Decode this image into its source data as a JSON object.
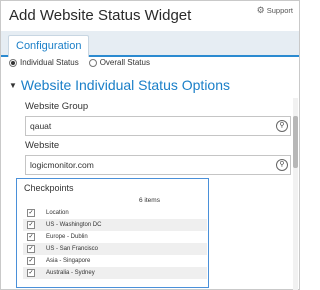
{
  "dialog": {
    "title": "Add Website Status Widget",
    "support_label": "Support",
    "support_icon": "gear-icon"
  },
  "tabs": [
    {
      "label": "Configuration",
      "active": true
    }
  ],
  "status_type": {
    "options": [
      {
        "label": "Individual Status",
        "selected": true
      },
      {
        "label": "Overall Status",
        "selected": false
      }
    ]
  },
  "section": {
    "title": "Website Individual Status Options",
    "expanded": true
  },
  "website_group": {
    "label": "Website Group",
    "value": "qauat"
  },
  "website": {
    "label": "Website",
    "value": "logicmonitor.com"
  },
  "checkpoints": {
    "label": "Checkpoints",
    "count_text": "6 items",
    "column_header": "Location",
    "items": [
      {
        "label": "US - Washington DC",
        "checked": true
      },
      {
        "label": "Europe - Dublin",
        "checked": true
      },
      {
        "label": "US - San Francisco",
        "checked": true
      },
      {
        "label": "Asia - Singapore",
        "checked": true
      },
      {
        "label": "Australia - Sydney",
        "checked": true
      }
    ]
  },
  "colors": {
    "accent": "#1a7fc8",
    "highlight_border": "#4a90d9",
    "tab_bar_bg": "#e6edf3"
  }
}
